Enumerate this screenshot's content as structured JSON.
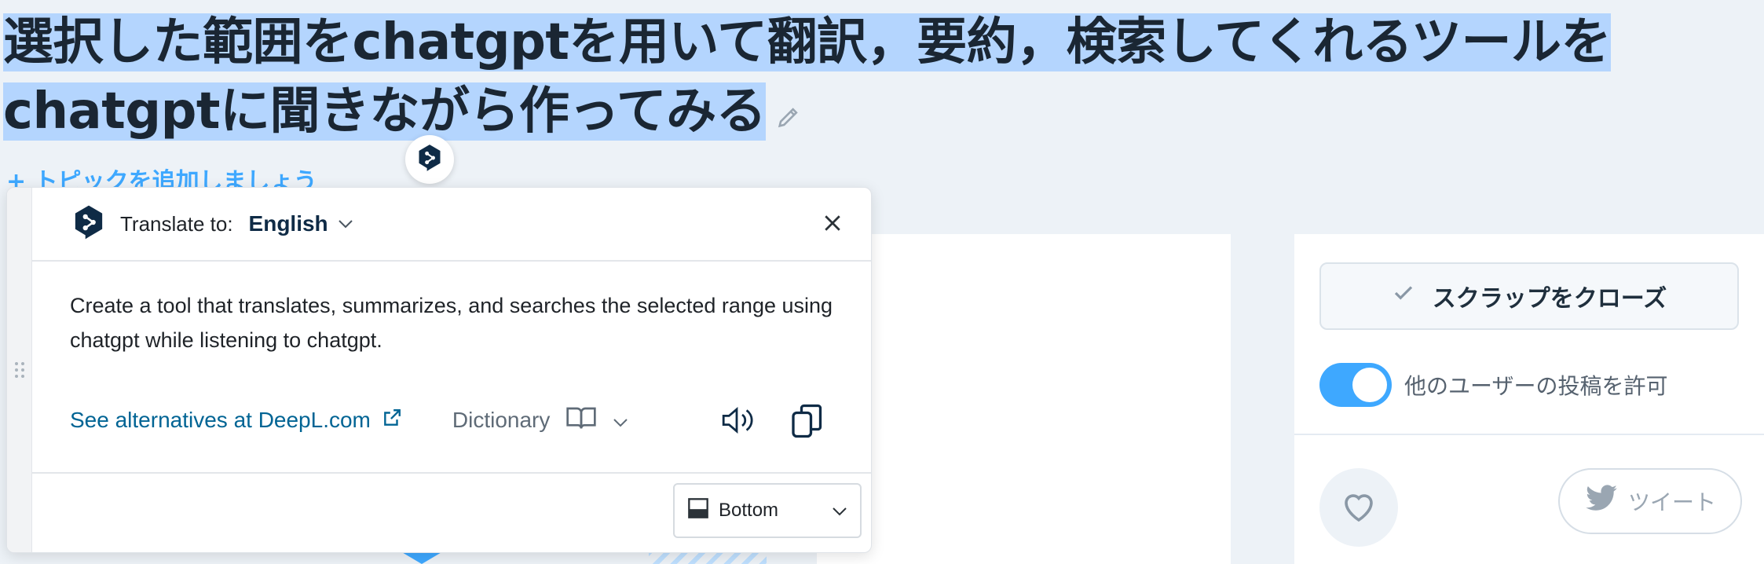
{
  "article": {
    "title": "選択した範囲をchatgptを用いて翻訳，要約，検索してくれるツールをchatgptに聞きながら作ってみる",
    "add_topic": "+ トピックを追加しましょう"
  },
  "sidebar": {
    "close_scrap_label": "スクラップをクローズ",
    "allow_posts_label": "他のユーザーの投稿を許可",
    "allow_posts_enabled": true,
    "tweet_label": "ツイート"
  },
  "deepl_popup": {
    "translate_to_label": "Translate to:",
    "target_language": "English",
    "translation_text": "Create a tool that translates, summarizes, and searches the selected range using chatgpt while listening to chatgpt.",
    "alternatives_link": "See alternatives at DeepL.com",
    "dictionary_label": "Dictionary",
    "position_option": "Bottom"
  },
  "colors": {
    "accent": "#3ea8ff",
    "selection": "#b4d5fe",
    "deepl_navy": "#0f2b46",
    "link": "#006494"
  },
  "icons": {
    "edit": "pencil-icon",
    "deepl": "deepl-logo-icon",
    "close": "close-icon",
    "external": "external-link-icon",
    "book": "book-icon",
    "speaker": "speaker-icon",
    "copy": "copy-icon",
    "check": "check-icon",
    "heart": "heart-icon",
    "twitter": "twitter-icon"
  }
}
